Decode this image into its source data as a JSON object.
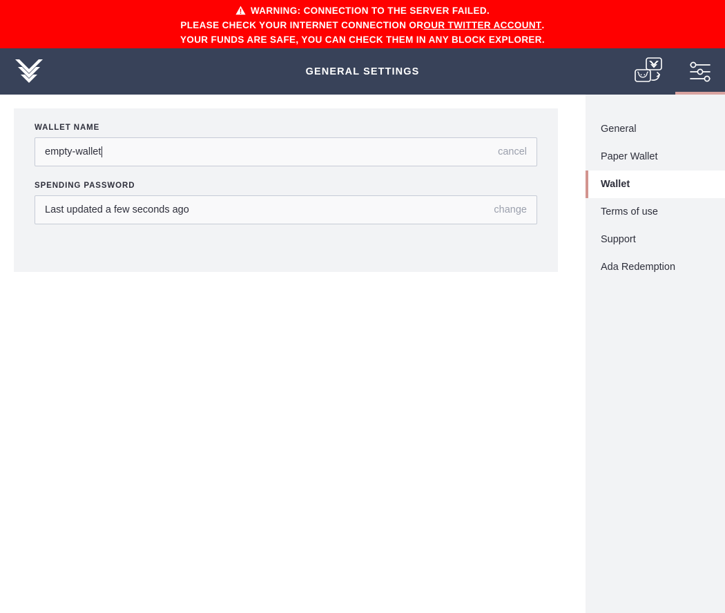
{
  "warning": {
    "icon": "warning-triangle-icon",
    "line1": "WARNING: CONNECTION TO THE SERVER FAILED.",
    "line2_prefix": "PLEASE CHECK YOUR INTERNET CONNECTION OR ",
    "line2_link": "OUR TWITTER ACCOUNT",
    "line2_suffix": ".",
    "line3": "YOUR FUNDS ARE SAFE, YOU CAN CHECK THEM IN ANY BLOCK EXPLORER.",
    "background": "#ff0000",
    "text_color": "#ffffff"
  },
  "topbar": {
    "logo_icon": "daedalus-logo-icon",
    "title": "GENERAL SETTINGS",
    "background": "#384259",
    "actions": [
      {
        "name": "wallet-switch-icon",
        "active": false
      },
      {
        "name": "settings-sliders-icon",
        "active": true
      }
    ],
    "active_indicator_color": "#d9a3a0"
  },
  "settings": {
    "wallet_name": {
      "label": "WALLET NAME",
      "value": "empty-wallet",
      "placeholder": "Wallet name",
      "action_label": "cancel"
    },
    "spending_password": {
      "label": "SPENDING PASSWORD",
      "value": "Last updated a few seconds ago",
      "action_label": "change"
    }
  },
  "menu": {
    "items": [
      {
        "label": "General",
        "active": false
      },
      {
        "label": "Paper Wallet",
        "active": false
      },
      {
        "label": "Wallet",
        "active": true
      },
      {
        "label": "Terms of use",
        "active": false
      },
      {
        "label": "Support",
        "active": false
      },
      {
        "label": "Ada Redemption",
        "active": false
      }
    ],
    "active_accent": "#d2948f",
    "background": "#f2f3f5"
  }
}
